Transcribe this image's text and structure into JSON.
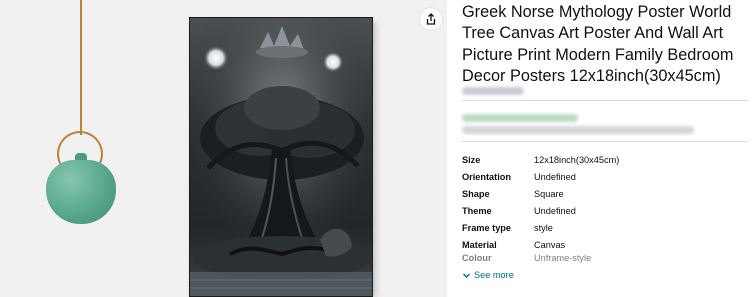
{
  "product": {
    "title": "Greek Norse Mythology Poster World Tree Canvas Art Poster And Wall Art Picture Print Modern Family Bedroom Decor Posters 12x18inch(30x45cm)"
  },
  "specs": [
    {
      "key": "Size",
      "value": "12x18inch(30x45cm)"
    },
    {
      "key": "Orientation",
      "value": "Undefined"
    },
    {
      "key": "Shape",
      "value": "Square"
    },
    {
      "key": "Theme",
      "value": "Undefined"
    },
    {
      "key": "Frame type",
      "value": "style"
    },
    {
      "key": "Material",
      "value": "Canvas"
    },
    {
      "key": "Colour",
      "value": "Unframe-style"
    }
  ],
  "see_more": {
    "label": "See more"
  },
  "icons": {
    "share": "share-icon",
    "chevron": "chevron-down-icon"
  },
  "colors": {
    "link": "#007185",
    "pendant": "#58a78c"
  }
}
